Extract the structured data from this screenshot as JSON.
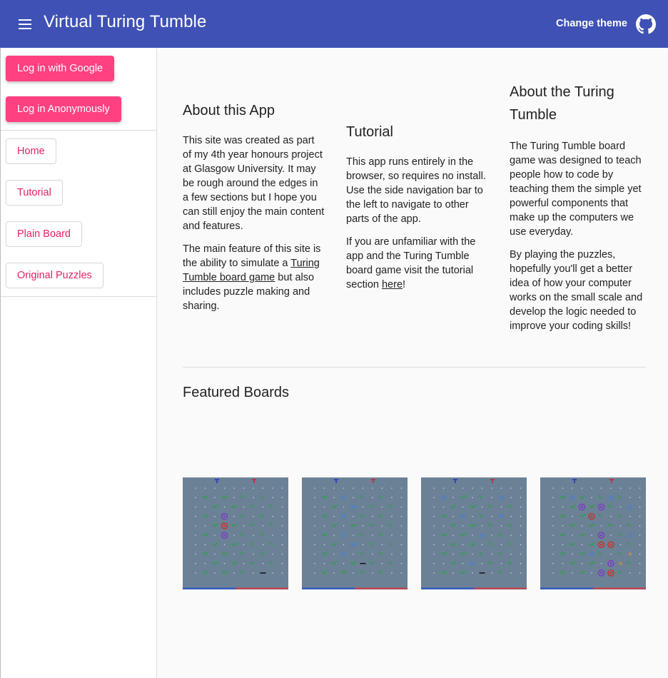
{
  "header": {
    "title": "Virtual Turing Tumble",
    "theme_button": "Change theme",
    "menu_icon": "hamburger-icon",
    "github_icon": "github-icon"
  },
  "sidenav": {
    "login_google": "Log in with Google",
    "login_anonymous": "Log in Anonymously",
    "items": [
      "Home",
      "Tutorial",
      "Plain Board",
      "Original Puzzles"
    ]
  },
  "about": {
    "title": "About this App",
    "p1": "This site was created as part of my 4th year honours project at Glasgow University. It may be rough around the edges in a few sections but I hope you can still enjoy the main content and features.",
    "p2_before": "The main feature of this site is the ability to simulate a ",
    "p2_link": "Turing Tumble board game",
    "p2_after": " but also includes puzzle making and sharing."
  },
  "tutorial": {
    "title": "Tutorial",
    "p1": "This app runs entirely in the browser, so requires no install. Use the side navigation bar to the left to navigate to other parts of the app.",
    "p2_before": "If you are unfamiliar with the app and the Turing Tumble board game visit the tutorial section ",
    "p2_link": "here",
    "p2_after": "!"
  },
  "turing": {
    "title": "About the Turing Tumble",
    "p1": "The Turing Tumble board game was designed to teach people how to code by teaching them the simple yet powerful components that make up the computers we use everyday.",
    "p2": "By playing the puzzles, hopefully you'll get a better idea of how your computer works on the small scale and develop the logic needed to improve your coding skills!"
  },
  "featured": {
    "title": "Featured Boards",
    "boards": [
      "board-1",
      "board-2",
      "board-3",
      "board-4"
    ]
  },
  "colors": {
    "primary": "#3f51b5",
    "accent": "#ff4081",
    "board_bg": "#6b8196",
    "ramp": "#2ea043",
    "bit": "#7b3fc4",
    "gear": "#c0392b"
  }
}
